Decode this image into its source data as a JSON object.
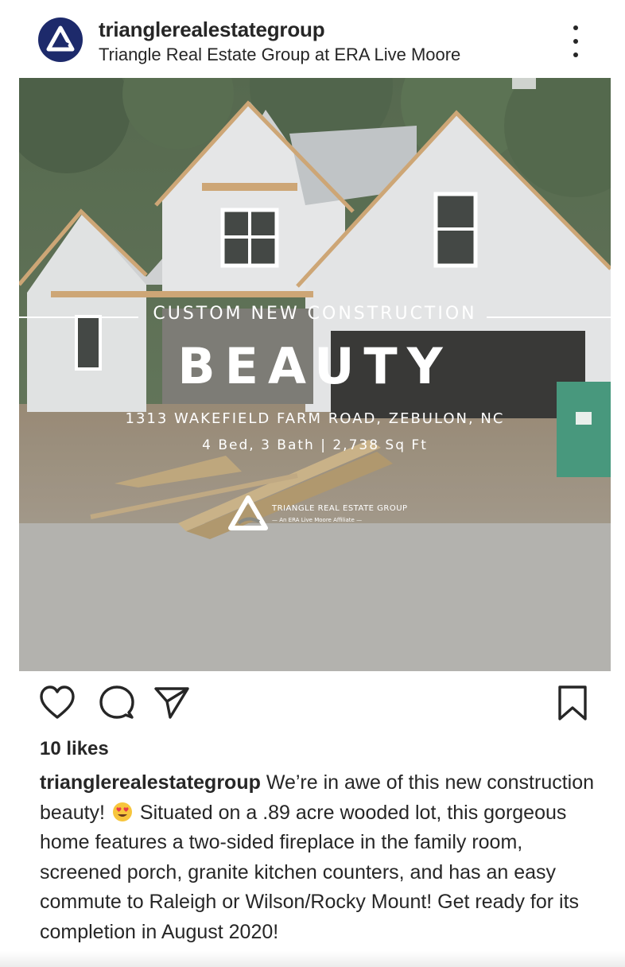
{
  "post": {
    "username": "trianglerealestategroup",
    "location": "Triangle Real Estate Group at ERA Live Moore",
    "image": {
      "overlay_top": "CUSTOM NEW CONSTRUCTION",
      "overlay_main": "BEAUTY",
      "overlay_address": "1313 WAKEFIELD FARM ROAD, ZEBULON, NC",
      "overlay_specs": "4 Bed, 3 Bath | 2,738 Sq Ft",
      "logo_name": "TRIANGLE REAL ESTATE GROUP",
      "logo_sub": "— An ERA Live Moore Affiliate —"
    },
    "likes": "10 likes",
    "caption": {
      "user": "trianglerealestategroup",
      "text_before_emoji": "We’re in awe of this new construction beauty!",
      "emoji": "smiling-face-with-heart-eyes",
      "text_after_emoji": "Situated on a .89 acre wooded lot, this gorgeous home features a two-sided fireplace in the family room, screened porch, granite kitchen counters, and has an easy commute to Raleigh or Wilson/Rocky Mount! Get ready for its completion in August 2020!"
    }
  },
  "icons": {
    "more": "more-options-icon",
    "like": "heart-icon",
    "comment": "comment-icon",
    "share": "paper-plane-icon",
    "save": "bookmark-icon"
  },
  "colors": {
    "text": "#262626",
    "avatar_bg": "#1d2a6b",
    "background": "#ffffff"
  }
}
